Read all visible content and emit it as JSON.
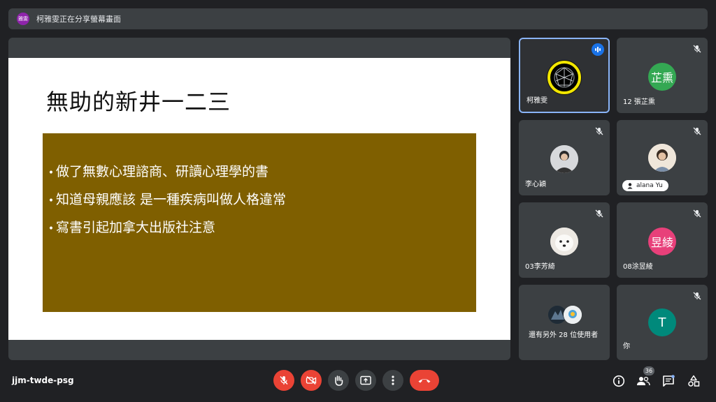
{
  "presenter_bar": {
    "avatar_text": "雅雯",
    "text": "柯雅雯正在分享螢幕畫面"
  },
  "slide": {
    "title": "無助的新井一二三",
    "bullets": [
      "做了無數心理諮商、研讀心理學的書",
      "知道母親應該 是一種疾病叫做人格違常",
      "寫書引起加拿大出版社注意"
    ],
    "bullet_marker": "•",
    "box_color": "#7f5f00"
  },
  "participants": [
    {
      "name": "柯雅雯",
      "state": "speaking",
      "avatar": "globe-photo"
    },
    {
      "name": "12 張芷熏",
      "state": "muted",
      "initials": "芷熏",
      "color": "#34a853"
    },
    {
      "name": "李心穎",
      "state": "muted",
      "avatar": "photo"
    },
    {
      "name": "alana Yu",
      "state": "muted",
      "avatar": "photo"
    },
    {
      "name": "03李芳綺",
      "state": "muted",
      "avatar": "dog-photo"
    },
    {
      "name": "08涂昱綾",
      "state": "muted",
      "initials": "昱綾",
      "color": "#e8407a"
    },
    {
      "name": "還有另外 28 位使用者",
      "state": "none",
      "avatar": "group"
    },
    {
      "name": "你",
      "state": "muted",
      "initials": "T",
      "color": "#00897b"
    }
  ],
  "bottom_bar": {
    "meeting_code": "jjm-twde-psg",
    "people_count": "36",
    "controls": [
      "mic-off-icon",
      "camera-off-icon",
      "raise-hand-icon",
      "present-icon",
      "more-icon",
      "end-call-icon"
    ],
    "right_icons": [
      "info-icon",
      "people-icon",
      "chat-icon",
      "activities-icon"
    ]
  },
  "colors": {
    "background": "#202124",
    "tile": "#3c4043",
    "danger": "#ea4335",
    "accent": "#8ab4f8"
  }
}
